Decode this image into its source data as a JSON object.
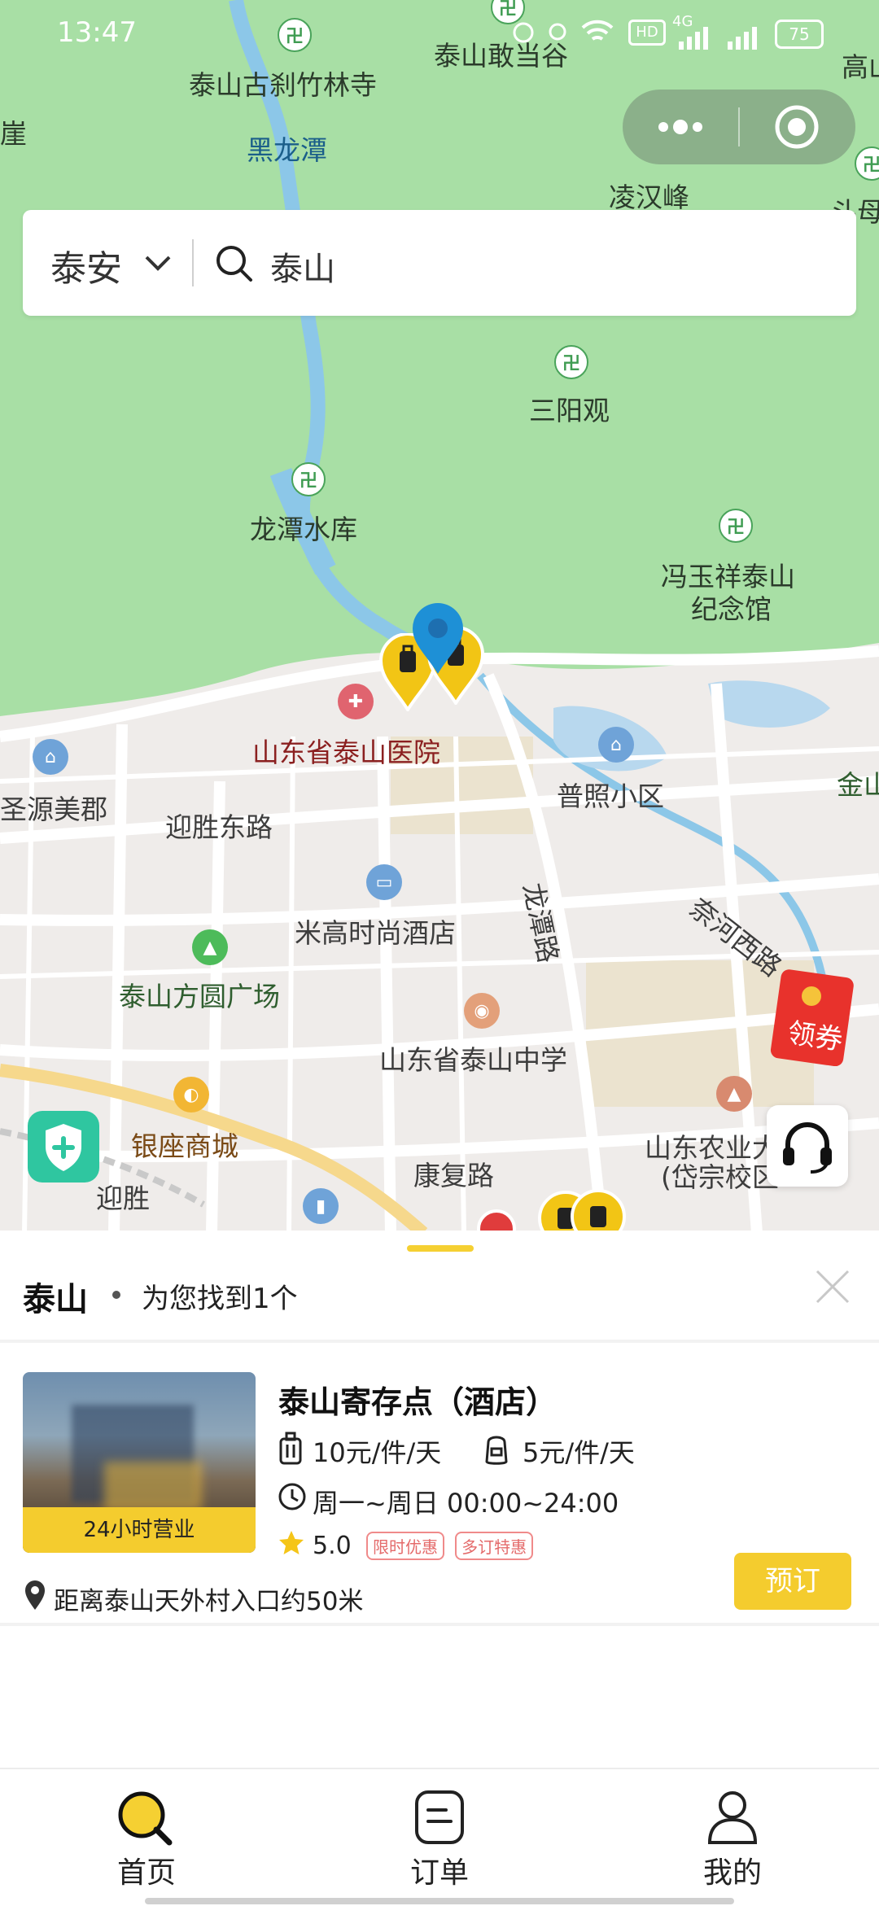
{
  "status_bar": {
    "time": "13:47",
    "network": "4G",
    "battery": "75"
  },
  "map": {
    "labels": {
      "zhulin_temple": "泰山古刹竹林寺",
      "gandang_valley": "泰山敢当谷",
      "gao_shan": "高山",
      "ya": "崖",
      "heilongtan": "黑龙潭",
      "linghan_peak": "凌汉峰",
      "doumu": "斗母",
      "sanyang_temple": "三阳观",
      "longtan_reservoir": "龙潭水库",
      "feng_yuxiang_1": "冯玉祥泰山",
      "feng_yuxiang_2": "纪念馆",
      "taishan_hospital": "山东省泰山医院",
      "puzhao_community": "普照小区",
      "jin": "金山",
      "shengyuan": "圣源美郡",
      "yingsheng_east_road": "迎胜东路",
      "longtan_road": "龙潭路",
      "naihe_west_road": "奈河西路",
      "migao_hotel": "米高时尚酒店",
      "taishan_square": "泰山方圆广场",
      "taishan_middle_school": "山东省泰山中学",
      "yinzuo_mall": "银座商城",
      "kangfu_road": "康复路",
      "agri_univ_1": "山东农业大",
      "agri_univ_2": "(岱宗校区",
      "yingsheng": "迎胜"
    },
    "coupon_label": "领券"
  },
  "search": {
    "city": "泰安",
    "query": "泰山"
  },
  "results": {
    "keyword": "泰山",
    "summary": "为您找到1个"
  },
  "store": {
    "name": "泰山寄存点（酒店）",
    "hours_badge": "24小时营业",
    "price_large": "10元/件/天",
    "price_small": "5元/件/天",
    "open_hours": "周一~周日 00:00~24:00",
    "rating": "5.0",
    "tags": [
      "限时优惠",
      "多订特惠"
    ],
    "distance": "距离泰山天外村入口约50米",
    "book_button": "预订"
  },
  "tabs": {
    "home": "首页",
    "orders": "订单",
    "mine": "我的"
  },
  "colors": {
    "brand_yellow": "#f5d032",
    "map_green": "#a9e0a6",
    "pin_blue": "#1e90d6"
  }
}
